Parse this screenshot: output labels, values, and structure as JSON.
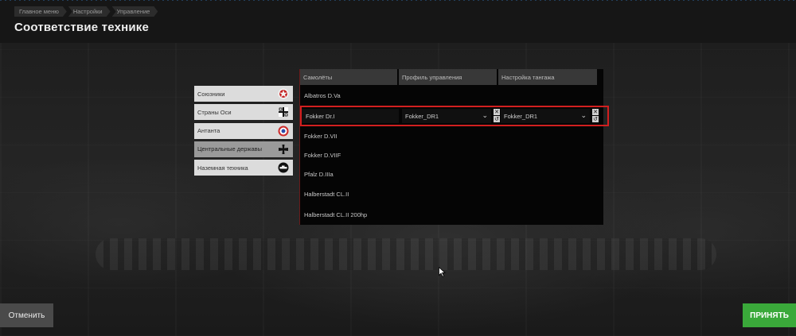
{
  "header": {
    "breadcrumbs": [
      "Главное меню",
      "Настройки",
      "Управление"
    ],
    "title": "Соответствие технике"
  },
  "categories": [
    {
      "label": "Союзники",
      "icon": "allies-roundel-icon"
    },
    {
      "label": "Страны Оси",
      "icon": "axis-cross-icon"
    },
    {
      "label": "Антанта",
      "icon": "entente-roundel-icon"
    },
    {
      "label": "Центральные державы",
      "icon": "iron-cross-icon",
      "active": true
    },
    {
      "label": "Наземная техника",
      "icon": "ground-vehicle-icon"
    }
  ],
  "table": {
    "columns": [
      "Самолёты",
      "Профиль управления",
      "Настройка тангажа"
    ],
    "rows": [
      "Albatros D.Va",
      "Fokker Dr.I",
      "Fokker D.VII",
      "Fokker D.VIIF",
      "Pfalz D.IIIa",
      "Halberstadt CL.II",
      "Halberstadt CL.II 200hp"
    ],
    "selected": {
      "name": "Fokker Dr.I",
      "profile": "Fokker_DR1",
      "pitch": "Fokker_DR1"
    }
  },
  "buttons": {
    "cancel": "Отменить",
    "accept": "ПРИНЯТЬ"
  },
  "colors": {
    "highlight": "#d21f1f",
    "accept": "#3aa93a"
  }
}
